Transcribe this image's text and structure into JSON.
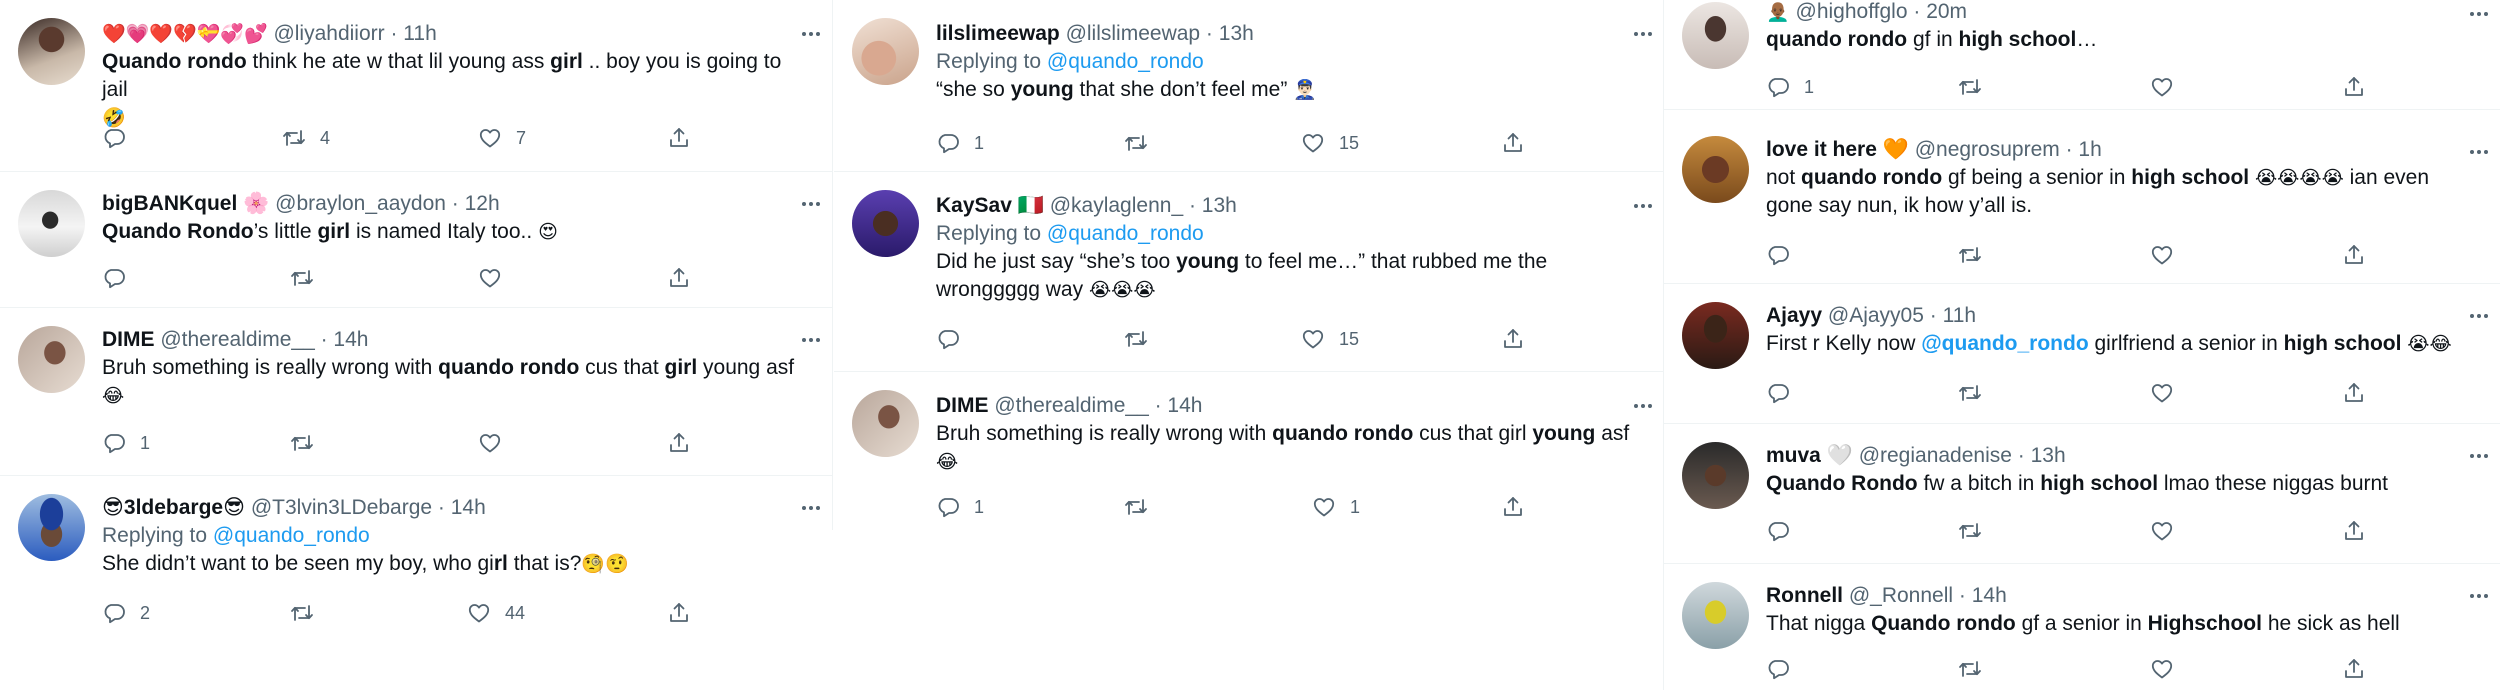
{
  "colors": {
    "link": "#1d9bf0",
    "muted": "#536471",
    "text": "#0f1419",
    "divider": "#eff3f4"
  },
  "icons": [
    "reply-icon",
    "retweet-icon",
    "like-icon",
    "share-icon",
    "more-icon"
  ],
  "col1": {
    "t1": {
      "emoji": "❤️💗❤️💔💝💞💕",
      "handle": "@liyahdiiorr · 11h",
      "text": {
        "a": "Quando rondo",
        "b": " think he ate w that lil young ass ",
        "c": "girl",
        "d": " .. boy you is going to jail",
        "e": "🤣"
      },
      "retweets": "4",
      "likes": "7"
    },
    "t2": {
      "name": "bigBANKquel 🌸",
      "handle": "@braylon_aaydon · 12h",
      "text": {
        "a": "Quando Rondo",
        "b": "’s little ",
        "c": "girl",
        "d": " is named Italy too.. ",
        "e": "😍"
      }
    },
    "t3": {
      "name": "DIME",
      "handle": "@therealdime__ · 14h",
      "text": {
        "a": "Bruh something is really wrong with ",
        "b": "quando rondo",
        "c": " cus that ",
        "d": "girl",
        "e": " young asf",
        "f": "😂"
      },
      "replies": "1"
    },
    "t4": {
      "name": "😎3ldebarge😎",
      "handle": "@T3lvin3LDebarge · 14h",
      "replying_prefix": "Replying to ",
      "replying_to": "@quando_rondo",
      "text": {
        "a": "She didn’t want to be seen my boy, who gi",
        "b": "rl",
        "c": " that is?",
        "d": "🧐🤨"
      },
      "replies": "2",
      "likes": "44"
    }
  },
  "col2": {
    "t1": {
      "name": "lilslimeewap",
      "handle": "@lilslimeewap · 13h",
      "replying_prefix": "Replying to ",
      "replying_to": "@quando_rondo",
      "text": {
        "a": "“she so ",
        "b": "young",
        "c": " that she don’t feel me” ",
        "d": "👮🏻‍♂️"
      },
      "replies": "1",
      "likes": "15"
    },
    "t2": {
      "name": "KaySav 🇮🇹",
      "handle": "@kaylaglenn_ · 13h",
      "replying_prefix": "Replying to ",
      "replying_to": "@quando_rondo",
      "text": {
        "a": "Did he just say “she’s too ",
        "b": "young",
        "c": " to feel me…” that rubbed me the wronggggg way ",
        "d": "😭😭😭"
      },
      "likes": "15"
    },
    "t3": {
      "name": "DIME",
      "handle": "@therealdime__ · 14h",
      "text": {
        "a": "Bruh something is really wrong with ",
        "b": "quando rondo",
        "c": " cus that girl ",
        "d": "young",
        "e": " asf",
        "f": "😂"
      },
      "replies": "1",
      "likes": "1"
    }
  },
  "col3": {
    "t1": {
      "emoji": "👨🏾‍🦲",
      "handle": "@highoffglo · 20m",
      "text": {
        "a": "quando rondo",
        "b": " gf in ",
        "c": "high school",
        "d": "…"
      },
      "replies": "1"
    },
    "t2": {
      "name": "love it here 🧡",
      "handle": "@negrosuprem · 1h",
      "text": {
        "a": "not ",
        "b": "quando rondo",
        "c": " gf being a senior in ",
        "d": "high school",
        "e": " ",
        "f": "😭😭😭😭",
        "g": " ian even gone say nun, ik how y’all is."
      }
    },
    "t3": {
      "name": "Ajayy",
      "handle": "@Ajayy05 · 11h",
      "text": {
        "a": "First r Kelly now ",
        "b": "@quando_rondo",
        "c": "  girlfriend a senior in ",
        "d": "high school",
        "e": " ",
        "f": "😭😂"
      }
    },
    "t4": {
      "name": "muva 🤍",
      "handle": "@regianadenise · 13h",
      "text": {
        "a": "Quando Rondo",
        "b": " fw a bitch in ",
        "c": "high school",
        "d": " lmao these niggas burnt"
      }
    },
    "t5": {
      "name": "Ronnell",
      "handle": "@_Ronnell · 14h",
      "text": {
        "a": "That nigga ",
        "b": "Quando rondo",
        "c": " gf a senior in ",
        "d": "Highschool",
        "e": " he sick as hell"
      }
    }
  }
}
